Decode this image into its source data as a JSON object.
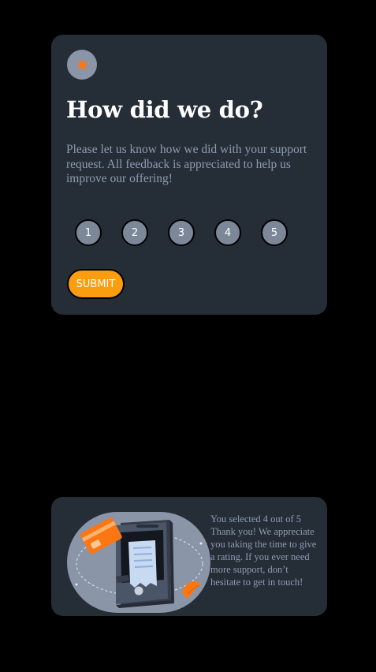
{
  "rating_card": {
    "icon": "star-icon",
    "heading": "How did we do?",
    "description": "Please let us know how we did with your support request. All feedback is appreciated to help us improve our offering!",
    "ratings": [
      "1",
      "2",
      "3",
      "4",
      "5"
    ],
    "submit_label": "SUBMIT"
  },
  "thanks_card": {
    "illustration": "phone-payment-illustration",
    "selected_text": "You selected 4 out of 5",
    "message": "Thank you! We appreciate you taking the time to give a rating. If you ever need more support, don’t hesitate to get in touch!"
  },
  "colors": {
    "background": "#000000",
    "card": "#252d37",
    "accent": "#fa9d0f",
    "star": "#fc7614",
    "muted_text": "#8d9cb1"
  }
}
